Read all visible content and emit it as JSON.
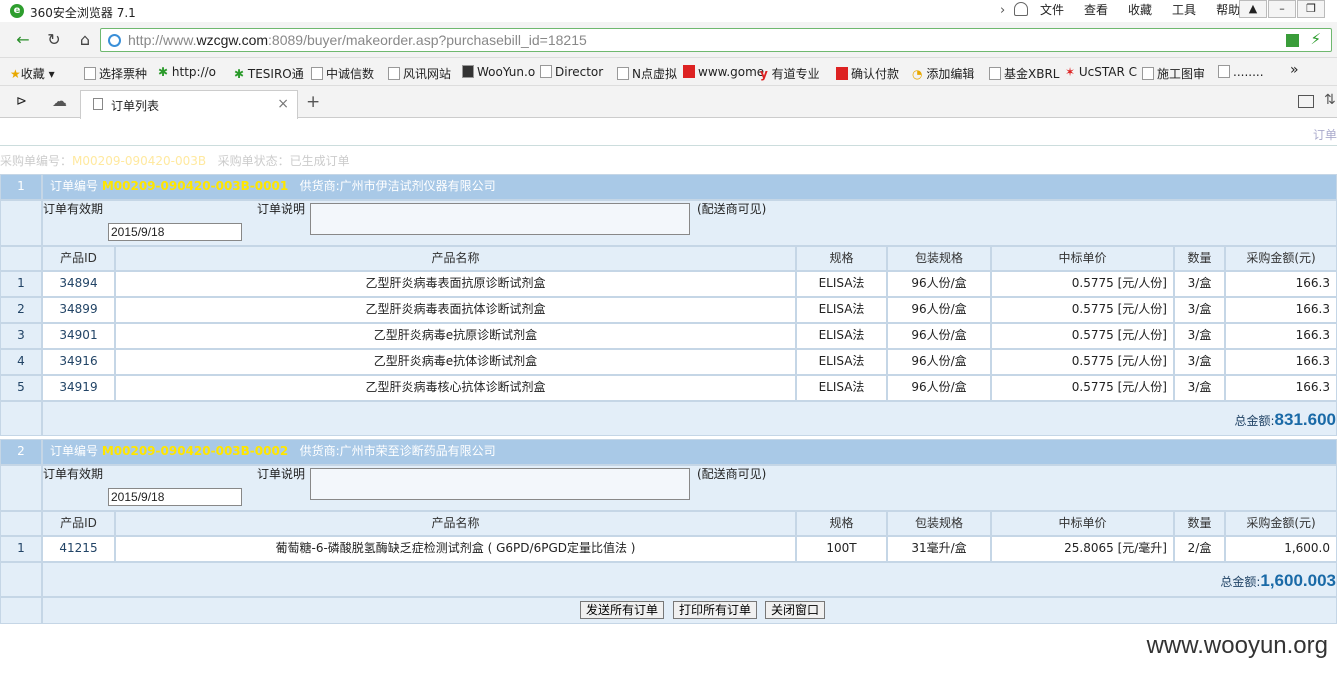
{
  "browser": {
    "title": "360安全浏览器 7.1",
    "menu": [
      "文件",
      "查看",
      "收藏",
      "工具",
      "帮助"
    ],
    "url_prefix": "http://www.",
    "url_host": "wzcgw.com",
    "url_rest": ":8089/buyer/makeorder.asp?purchasebill_id=18215",
    "bookmarks": [
      "收藏",
      "选择票种",
      "http://o",
      "TESIRO通",
      "中诚信数",
      "风讯网站",
      "WooYun.o",
      "Director",
      "N点虚拟",
      "www.gome",
      "有道专业",
      "确认付款",
      "添加编辑",
      "基金XBRL",
      "UcSTAR C",
      "施工图审",
      "........"
    ],
    "tab_label": "订单列表"
  },
  "page": {
    "topright": "订单",
    "bill_label": "采购单编号：",
    "bill_no": "M00209-090420-003B",
    "status_label": "采购单状态：已生成订单"
  },
  "common": {
    "order_no_label": "订单编号",
    "supplier_label": "供货商:",
    "validity_label": "订单有效期",
    "desc_label": "订单说明",
    "visible_note": "(配送商可见)",
    "col_id": "产品ID",
    "col_name": "产品名称",
    "col_spec": "规格",
    "col_pack": "包装规格",
    "col_price": "中标单价",
    "col_qty": "数量",
    "col_amount": "采购金额(元)",
    "total_label": "总金额:"
  },
  "orders": [
    {
      "index": "1",
      "order_no": "M00209-090420-003B-0001",
      "supplier": "广州市伊洁试剂仪器有限公司",
      "validity": "2015/9/18",
      "total": "831.600",
      "items": [
        {
          "n": "1",
          "id": "34894",
          "name": "乙型肝炎病毒表面抗原诊断试剂盒",
          "spec": "ELISA法",
          "pack": "96人份/盒",
          "price": "0.5775 [元/人份]",
          "qty": "3/盒",
          "amount": "166.3"
        },
        {
          "n": "2",
          "id": "34899",
          "name": "乙型肝炎病毒表面抗体诊断试剂盒",
          "spec": "ELISA法",
          "pack": "96人份/盒",
          "price": "0.5775 [元/人份]",
          "qty": "3/盒",
          "amount": "166.3"
        },
        {
          "n": "3",
          "id": "34901",
          "name": "乙型肝炎病毒e抗原诊断试剂盒",
          "spec": "ELISA法",
          "pack": "96人份/盒",
          "price": "0.5775 [元/人份]",
          "qty": "3/盒",
          "amount": "166.3"
        },
        {
          "n": "4",
          "id": "34916",
          "name": "乙型肝炎病毒e抗体诊断试剂盒",
          "spec": "ELISA法",
          "pack": "96人份/盒",
          "price": "0.5775 [元/人份]",
          "qty": "3/盒",
          "amount": "166.3"
        },
        {
          "n": "5",
          "id": "34919",
          "name": "乙型肝炎病毒核心抗体诊断试剂盒",
          "spec": "ELISA法",
          "pack": "96人份/盒",
          "price": "0.5775 [元/人份]",
          "qty": "3/盒",
          "amount": "166.3"
        }
      ]
    },
    {
      "index": "2",
      "order_no": "M00209-090420-003B-0002",
      "supplier": "广州市荣至诊断药品有限公司",
      "validity": "2015/9/18",
      "total": "1,600.003",
      "items": [
        {
          "n": "1",
          "id": "41215",
          "name": "葡萄糖-6-磷酸脱氢酶缺乏症检测试剂盒 ( G6PD/6PGD定量比值法 )",
          "spec": "100T",
          "pack": "31毫升/盒",
          "price": "25.8065 [元/毫升]",
          "qty": "2/盒",
          "amount": "1,600.0"
        }
      ]
    }
  ],
  "buttons": {
    "send": "发送所有订单",
    "print": "打印所有订单",
    "close": "关闭窗口"
  },
  "watermark": "www.wooyun.org"
}
